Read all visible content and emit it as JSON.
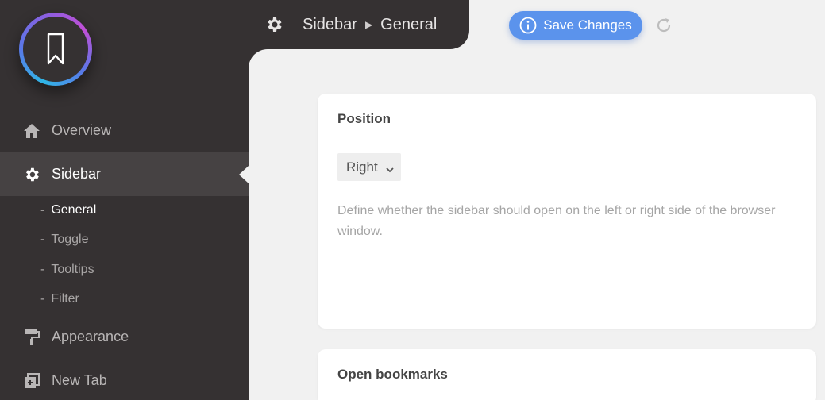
{
  "sidebar": {
    "logo_icon": "bookmark-icon",
    "items": [
      {
        "label": "Overview",
        "icon": "home-icon",
        "active": false
      },
      {
        "label": "Sidebar",
        "icon": "gear-icon",
        "active": true
      },
      {
        "label": "Appearance",
        "icon": "paint-roller-icon",
        "active": false
      },
      {
        "label": "New Tab",
        "icon": "new-tab-icon",
        "active": false
      }
    ],
    "sub_items": [
      {
        "label": "General",
        "active": true
      },
      {
        "label": "Toggle",
        "active": false
      },
      {
        "label": "Tooltips",
        "active": false
      },
      {
        "label": "Filter",
        "active": false
      }
    ],
    "sub_prefix": "-"
  },
  "header": {
    "icon": "gear-icon",
    "breadcrumb": [
      "Sidebar",
      "General"
    ]
  },
  "toolbar": {
    "save_label": "Save Changes",
    "save_icon": "info-icon",
    "reset_icon": "refresh-icon"
  },
  "cards": [
    {
      "title": "Position",
      "select_value": "Right",
      "description": "Define whether the sidebar should open on the left or right side of the browser window."
    },
    {
      "title": "Open bookmarks"
    }
  ],
  "colors": {
    "sidebar_bg": "#353132",
    "active_bg": "#464243",
    "accent": "#5b93ec",
    "page_bg": "#f1f1f1"
  }
}
